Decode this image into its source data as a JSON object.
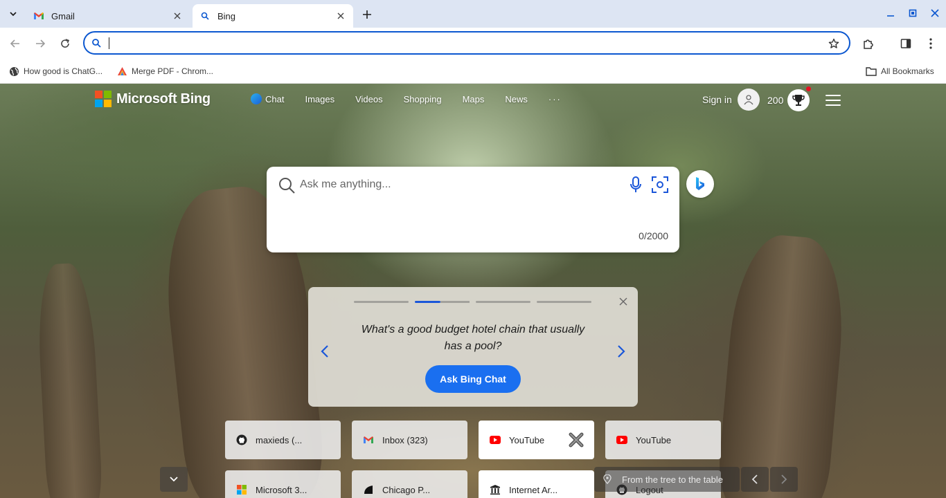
{
  "browser": {
    "tabs": [
      {
        "title": "Gmail",
        "favicon": "gmail-icon",
        "active": false
      },
      {
        "title": "Bing",
        "favicon": "search-icon",
        "active": true
      }
    ],
    "omnibox": {
      "value": "",
      "placeholder": ""
    },
    "bookmarks": [
      {
        "label": "How good is ChatG...",
        "icon": "globe-icon"
      },
      {
        "label": "Merge PDF - Chrom...",
        "icon": "pdf-app-icon"
      }
    ],
    "all_bookmarks_label": "All Bookmarks"
  },
  "bing": {
    "logo_text": "Microsoft Bing",
    "nav": [
      "Chat",
      "Images",
      "Videos",
      "Shopping",
      "Maps",
      "News"
    ],
    "more_label": "···",
    "sign_in": "Sign in",
    "points": "200",
    "search": {
      "placeholder": "Ask me anything...",
      "counter": "0/2000"
    },
    "carousel": {
      "question": "What's a good budget hotel chain that usually has a pool?",
      "button": "Ask Bing Chat",
      "slide_count": 4,
      "active_slide": 2
    },
    "quick_links": [
      {
        "label": "maxieds (...",
        "icon": "github-icon"
      },
      {
        "label": "Inbox (323)",
        "icon": "gmail-icon"
      },
      {
        "label": "YouTube",
        "icon": "youtube-icon"
      },
      {
        "label": "YouTube",
        "icon": "youtube-icon"
      },
      {
        "label": "Microsoft 3...",
        "icon": "microsoft-icon"
      },
      {
        "label": "Chicago P...",
        "icon": "chicago-icon"
      },
      {
        "label": "Internet Ar...",
        "icon": "archive-icon"
      },
      {
        "label": "Logout",
        "icon": "github-icon"
      }
    ],
    "image_caption": "From the tree to the table"
  },
  "colors": {
    "accent": "#0b57d0",
    "bing_blue": "#1a6ff0",
    "youtube_red": "#ff0000",
    "notification_red": "#e81123"
  }
}
